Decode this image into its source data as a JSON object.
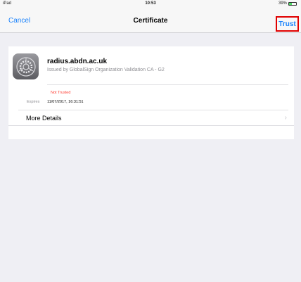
{
  "status_bar": {
    "device": "iPad",
    "time": "10:53",
    "battery_text": "39%",
    "battery_level": 0.39
  },
  "nav": {
    "cancel": "Cancel",
    "title": "Certificate",
    "trust": "Trust"
  },
  "certificate": {
    "icon": "settings-gear-icon",
    "name": "radius.abdn.ac.uk",
    "issuer": "Issued by GlobalSign Organization Validation CA - G2",
    "status": "Not Trusted",
    "expires_label": "Expires",
    "expires_value": "11/07/2017, 16:31:51",
    "more_details": "More Details"
  },
  "colors": {
    "accent": "#1a82fb",
    "warning": "#ff3b30",
    "highlight_box": "#e00000"
  }
}
